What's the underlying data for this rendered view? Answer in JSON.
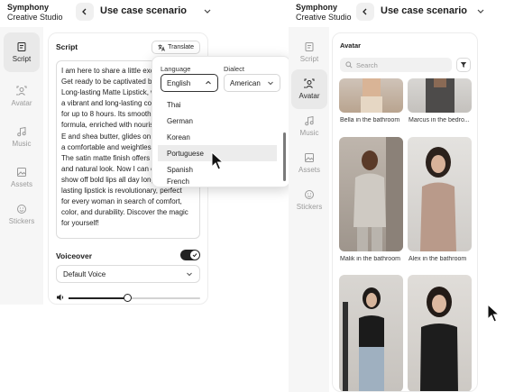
{
  "left_app": {
    "brand": {
      "line1": "Symphony",
      "line2": "Creative Studio"
    },
    "header": {
      "title": "Use case scenario"
    },
    "nav": [
      {
        "label": "Script",
        "icon": "script-icon",
        "active": true
      },
      {
        "label": "Avatar",
        "icon": "avatar-icon",
        "active": false
      },
      {
        "label": "Music",
        "icon": "music-icon",
        "active": false
      },
      {
        "label": "Assets",
        "icon": "assets-icon",
        "active": false
      },
      {
        "label": "Stickers",
        "icon": "stickers-icon",
        "active": false
      }
    ],
    "script": {
      "label": "Script",
      "translate_label": "Translate",
      "text_lines": [
        "I am here to share a little exci",
        "Get ready to be captivated by",
        "Long-lasting Matte Lipstick, w",
        "a vibrant and long-lasting col",
        "for up to 8 hours. Its smooth",
        "formula, enriched with nourishi",
        "E and shea butter, glides on eas",
        "a comfortable and weightless fe",
        "The satin matte finish offers an",
        "and natural look. Now I can con",
        "show off bold lips all day long. T",
        "lasting lipstick is revolutionary, perfect",
        "for every woman in search of comfort,",
        "color, and durability. Discover the magic",
        "for yourself!"
      ]
    },
    "voiceover": {
      "label": "Voiceover",
      "enabled": true,
      "voice": "Default Voice",
      "volume": 0.45
    },
    "translate_popup": {
      "language_label": "Language",
      "language_value": "English",
      "dialect_label": "Dialect",
      "dialect_value": "American",
      "options": [
        "Thai",
        "German",
        "Korean",
        "Portuguese",
        "Spanish",
        "French"
      ],
      "hovered": "Portuguese"
    }
  },
  "right_app": {
    "brand": {
      "line1": "Symphony",
      "line2": "Creative Studio"
    },
    "header": {
      "title": "Use case scenario"
    },
    "nav": [
      {
        "label": "Script",
        "icon": "script-icon",
        "active": false
      },
      {
        "label": "Avatar",
        "icon": "avatar-icon",
        "active": true
      },
      {
        "label": "Music",
        "icon": "music-icon",
        "active": false
      },
      {
        "label": "Assets",
        "icon": "assets-icon",
        "active": false
      },
      {
        "label": "Stickers",
        "icon": "stickers-icon",
        "active": false
      }
    ],
    "avatar": {
      "label": "Avatar",
      "search_placeholder": "Search",
      "items": [
        {
          "name": "Bella in the bathroom"
        },
        {
          "name": "Marcus in the bedro..."
        },
        {
          "name": "Malik in the bathroom"
        },
        {
          "name": "Alex in the bathroom"
        },
        {
          "name": ""
        },
        {
          "name": ""
        }
      ]
    }
  },
  "colors": {
    "accent": "#222222",
    "rail_bg": "#f6f6f6",
    "hover": "#ececec"
  }
}
